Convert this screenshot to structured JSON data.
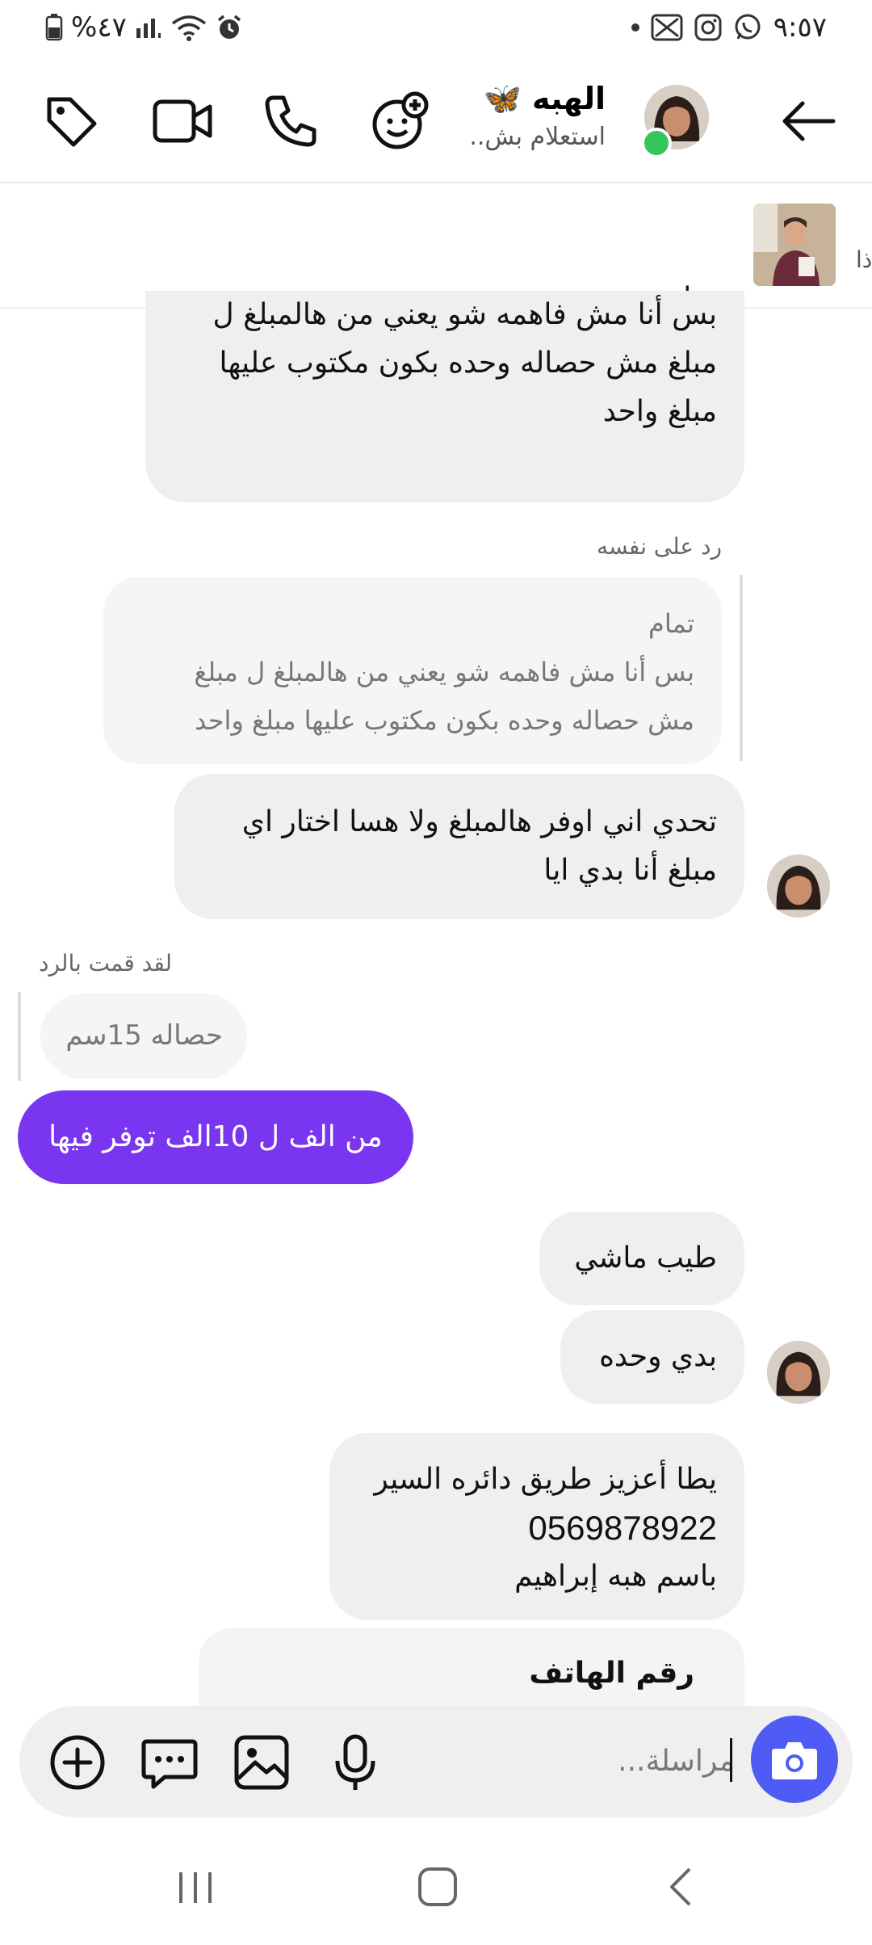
{
  "status_bar": {
    "time": "٩:٥٧",
    "battery": "%٤٧"
  },
  "header": {
    "contact_name": "الهبه ⁦🦋⁩",
    "contact_subtitle": "استعلام بش.."
  },
  "reply_preview": {
    "edge_text": "ذا"
  },
  "messages": {
    "m1_lines": [
      "تمام",
      "بس أنا مش فاهمه شو يعني من هالمبلغ ل",
      "مبلغ مش حصاله وحده بكون مكتوب عليها",
      "مبلغ واحد"
    ],
    "m2_label": "رد على نفسه",
    "m2_quote_lines": [
      "تمام",
      "بس أنا مش فاهمه شو يعني من هالمبلغ ل مبلغ",
      "مش حصاله وحده بكون مكتوب عليها مبلغ واحد"
    ],
    "m2_lines": [
      "تحدي اني اوفر هالمبلغ ولا هسا اختار اي",
      "مبلغ أنا بدي ايا"
    ],
    "m3_label": "لقد قمت بالرد",
    "m3_quote": "حصاله 15سم",
    "m3_text": "من الف ل 10الف توفر فيها",
    "m4_text": "طيب ماشي",
    "m5_text": "بدي وحده",
    "m6_lines": [
      "يطا أعزيز طريق دائره السير",
      "0569878922",
      "باسم هبه إبراهيم"
    ],
    "m7_title": "رقم الهاتف"
  },
  "composer": {
    "placeholder": "مراسلة..."
  },
  "colors": {
    "accent_purple": "#7a35f0",
    "camera_blue": "#4e5cf5",
    "online_green": "#35c759"
  },
  "icons": [
    "back-arrow-icon",
    "sticker-add-icon",
    "phone-icon",
    "video-camera-icon",
    "tag-icon",
    "camera-icon",
    "mic-icon",
    "gallery-icon",
    "sticker-chat-icon",
    "plus-icon",
    "nav-recents-icon",
    "nav-home-icon",
    "nav-back-icon"
  ]
}
